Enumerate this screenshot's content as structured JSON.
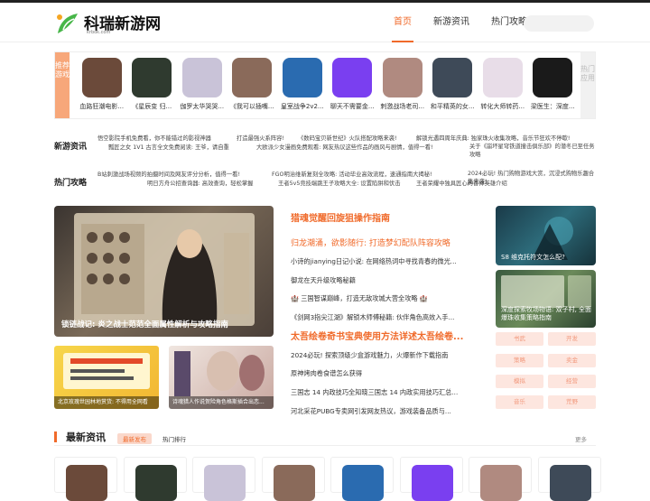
{
  "header": {
    "logo_name": "科瑞新游网",
    "logo_domain": "krbok.com",
    "nav": [
      "首页",
      "新游资讯",
      "热门攻略"
    ],
    "active_nav": 0
  },
  "carousel": {
    "left_label": "推荐游戏",
    "right_label": "热门应用",
    "apps": [
      {
        "label": "血路狂潮电影...",
        "color": "#6b4a3a"
      },
      {
        "label": "《星辰变 归...",
        "color": "#2f3a2f"
      },
      {
        "label": "伽罗太华哭哭...",
        "color": "#c9c3d8"
      },
      {
        "label": "《我可以插嘴...",
        "color": "#8a6a5a"
      },
      {
        "label": "皇室战争2v2...",
        "color": "#2a6bb0"
      },
      {
        "label": "聊天不需要金...",
        "color": "#7a3ff0"
      },
      {
        "label": "刺激战场老司...",
        "color": "#b08a80"
      },
      {
        "label": "和平精英的女...",
        "color": "#3e4a58"
      },
      {
        "label": "转化大师转药...",
        "color": "#e8dde8"
      },
      {
        "label": "梁医生：深度...",
        "color": "#1a1a1a"
      }
    ]
  },
  "news_row": {
    "title": "新游资讯",
    "links": [
      "悟空影院手机免费看，你不能错过的影视神器",
      "打造最强火系阵容!",
      "《数码宝贝新世纪》火队搭配攻略来袭!",
      "解锁光遇四周年庆典: 独家珠火收集攻略，音乐节狂欢不停歇!",
      "瓢匠之女 1V1 古言全文免费阅读: 王爷，请自重",
      "大欧派少女漫画免费观看: 网友热议这些作品的画风与剧情，值得一看!",
      "关于《崩坏星穹铁道撞击俱乐部》的潜冬已至任务攻略"
    ]
  },
  "guide_row": {
    "title": "热门攻略",
    "links": [
      "B站刺激战场视频的拍摄时间及网友评分分析，值得一看!",
      "FGO明治维新复刻全攻略: 活动毕业高效流程，速通指南大揭秘!",
      "2024必玩! 热门购物游戏大赏，沉浸式购物乐趣合集来袭!",
      "明日方舟公招查询器: 高效查询，轻松掌握",
      "王者5v5竞技端跳王子攻略大全: 设置陷阱和伏击",
      "王者荣耀中独具匠心的音律英雄介绍"
    ]
  },
  "feature": {
    "caption": "锁链战记: 炎之战士范范全面属性解析与攻略指南"
  },
  "small_thumbs": [
    {
      "caption": "北京玫瑰世园林地赏货: 不得用全网看"
    },
    {
      "caption": "诗魂猎人作说贺险角色格斯插合出恋..."
    }
  ],
  "mid_list": {
    "head1": "猎魂觉醒回旋狙操作指南",
    "head2": "归龙潮涌，欲影随行: 打造梦幻配队阵容攻略",
    "items1": [
      "小诗的jianying日记小说: 在网络热词中寻找青春的微光...",
      "御龙在天升级攻略秘籍",
      "🏰 三国智谋巅峰，打造无敌攻城大营全攻略 🏰",
      "《剑网3指尖江湖》解锁木师傅秘籍: 伙伴角色高效入手..."
    ],
    "head3": "太吾绘卷奇书宝典使用方法详述太吾绘卷...",
    "items2": [
      "2024必玩! 探索顶级少盒游戏魅力，火爆新作下载指南",
      "原神烤肉卷食谱怎么获得",
      "三国志 14 内政技巧全知晓三国志 14 内政实用技巧汇总...",
      "河北采花PUBG专卖网引发网友热议，游戏装备品质与..."
    ]
  },
  "right_cards": [
    {
      "caption": "S8 维克托符文怎么配?"
    },
    {
      "caption": "深度探索牧场物语: 双子村, 全面爆珠收集策略指南"
    }
  ],
  "tags": [
    "书武",
    "开发",
    "策略",
    "卖金",
    "模拟",
    "经营",
    "音乐",
    "荒野"
  ],
  "latest": {
    "title": "最新资讯",
    "tab1": "最新发布",
    "tab2": "热门排行",
    "more": "更多"
  },
  "bottom_apps": [
    "#6b4a3a",
    "#2f3a2f",
    "#c9c3d8",
    "#8a6a5a",
    "#2a6bb0",
    "#7a3ff0",
    "#b08a80",
    "#3e4a58"
  ]
}
